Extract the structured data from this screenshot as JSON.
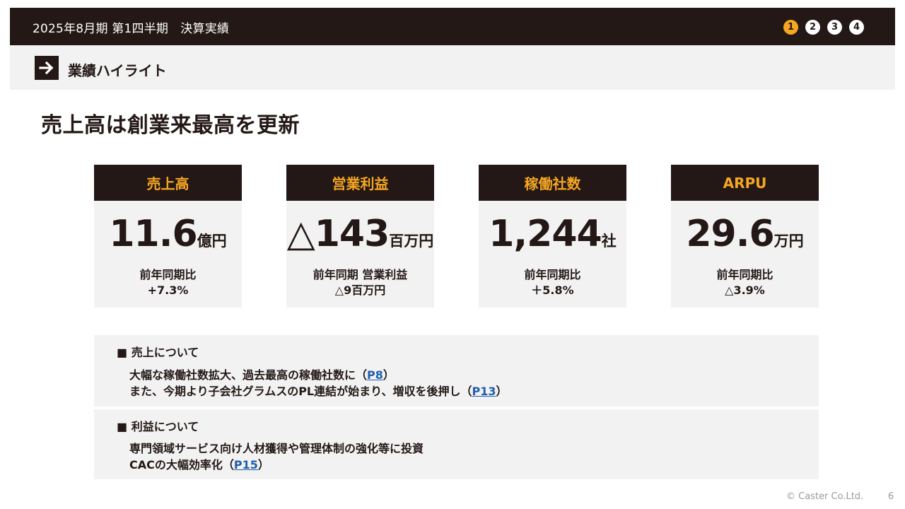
{
  "header": {
    "title": "2025年8月期 第1四半期　決算実績",
    "pages": [
      "1",
      "2",
      "3",
      "4"
    ],
    "active_page": "1"
  },
  "section": {
    "icon": "arrow-right-icon",
    "title": "業績ハイライト"
  },
  "headline": "売上高は創業来最高を更新",
  "kpis": [
    {
      "label": "売上高",
      "value": "11.6",
      "unit": "億円",
      "sub1": "前年同期比",
      "sub2": "+7.3%"
    },
    {
      "label": "営業利益",
      "value": "△143",
      "unit": "百万円",
      "sub1": "前年同期 営業利益",
      "sub2": "△9百万円"
    },
    {
      "label": "稼働社数",
      "value": "1,244",
      "unit": "社",
      "sub1": "前年同期比",
      "sub2": "＋5.8%"
    },
    {
      "label": "ARPU",
      "value": "29.6",
      "unit": "万円",
      "sub1": "前年同期比",
      "sub2": "△3.9%"
    }
  ],
  "notes": {
    "sales": {
      "heading": "■ 売上について",
      "line1_text": "大幅な稼働社数拡大、過去最高の稼働社数に（",
      "line1_ref": "P8",
      "line1_close": "）",
      "line2_text": "また、今期より子会社グラムスのPL連結が始まり、増収を後押し（",
      "line2_ref": "P13",
      "line2_close": "）"
    },
    "profit": {
      "heading": "■ 利益について",
      "line1_text": "専門領域サービス向け人材獲得や管理体制の強化等に投資",
      "line2_text": "CACの大幅効率化（",
      "line2_ref": "P15",
      "line2_close": "）"
    }
  },
  "footer": {
    "copyright": "© Caster Co.Ltd.",
    "page_number": "6"
  },
  "colors": {
    "dark": "#231815",
    "accent": "#f5a623",
    "panel": "#f2f2f2",
    "link": "#1f5fae"
  }
}
